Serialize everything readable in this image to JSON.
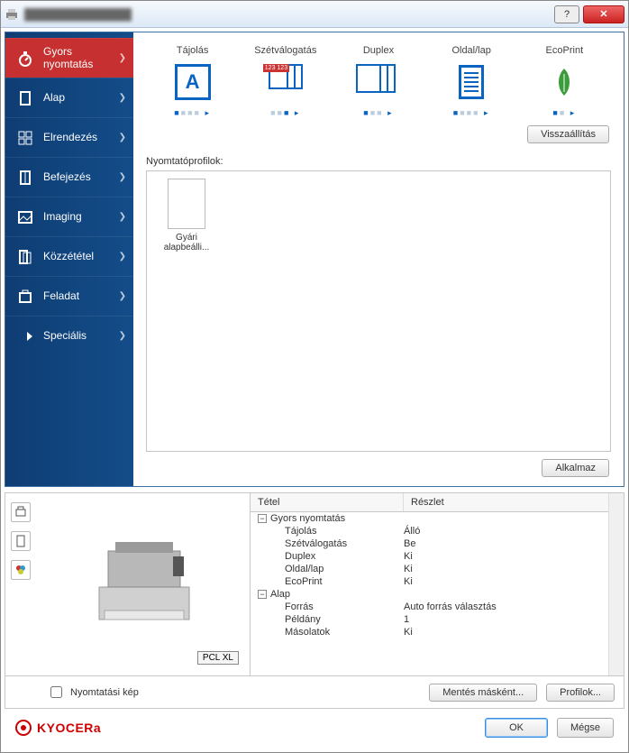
{
  "titlebar": {
    "title": "██████████████",
    "help": "?",
    "close": "✕"
  },
  "sidebar": {
    "items": [
      {
        "label": "Gyors\nnyomtatás",
        "icon": "stopwatch-icon"
      },
      {
        "label": "Alap",
        "icon": "page-icon"
      },
      {
        "label": "Elrendezés",
        "icon": "layout-icon"
      },
      {
        "label": "Befejezés",
        "icon": "booklet-icon"
      },
      {
        "label": "Imaging",
        "icon": "image-icon"
      },
      {
        "label": "Közzététel",
        "icon": "publish-icon"
      },
      {
        "label": "Feladat",
        "icon": "job-icon"
      },
      {
        "label": "Speciális",
        "icon": "arrow-icon"
      }
    ]
  },
  "quick": {
    "options": [
      {
        "title": "Tájolás",
        "icon": "orientation-icon"
      },
      {
        "title": "Szétválogatás",
        "icon": "collate-icon"
      },
      {
        "title": "Duplex",
        "icon": "duplex-icon"
      },
      {
        "title": "Oldal/lap",
        "icon": "pages-per-sheet-icon"
      },
      {
        "title": "EcoPrint",
        "icon": "ecoprint-icon"
      }
    ],
    "reset_label": "Visszaállítás",
    "profiles_label": "Nyomtatóprofilok:",
    "profile_item": "Gyári alapbeálli...",
    "apply_label": "Alkalmaz"
  },
  "details": {
    "col1": "Tétel",
    "col2": "Részlet",
    "groups": [
      {
        "name": "Gyors nyomtatás",
        "rows": [
          {
            "k": "Tájolás",
            "v": "Álló"
          },
          {
            "k": "Szétválogatás",
            "v": "Be"
          },
          {
            "k": "Duplex",
            "v": "Ki"
          },
          {
            "k": "Oldal/lap",
            "v": "Ki"
          },
          {
            "k": "EcoPrint",
            "v": "Ki"
          }
        ]
      },
      {
        "name": "Alap",
        "rows": [
          {
            "k": "Forrás",
            "v": "Auto forrás választás"
          },
          {
            "k": "Példány",
            "v": "1"
          },
          {
            "k": "Másolatok",
            "v": "Ki"
          }
        ]
      }
    ]
  },
  "preview": {
    "badge": "PCL XL",
    "checkbox": "Nyomtatási kép"
  },
  "footer": {
    "save_as": "Mentés másként...",
    "profiles": "Profilok...",
    "brand": "KYOCERa",
    "ok": "OK",
    "cancel": "Mégse"
  }
}
